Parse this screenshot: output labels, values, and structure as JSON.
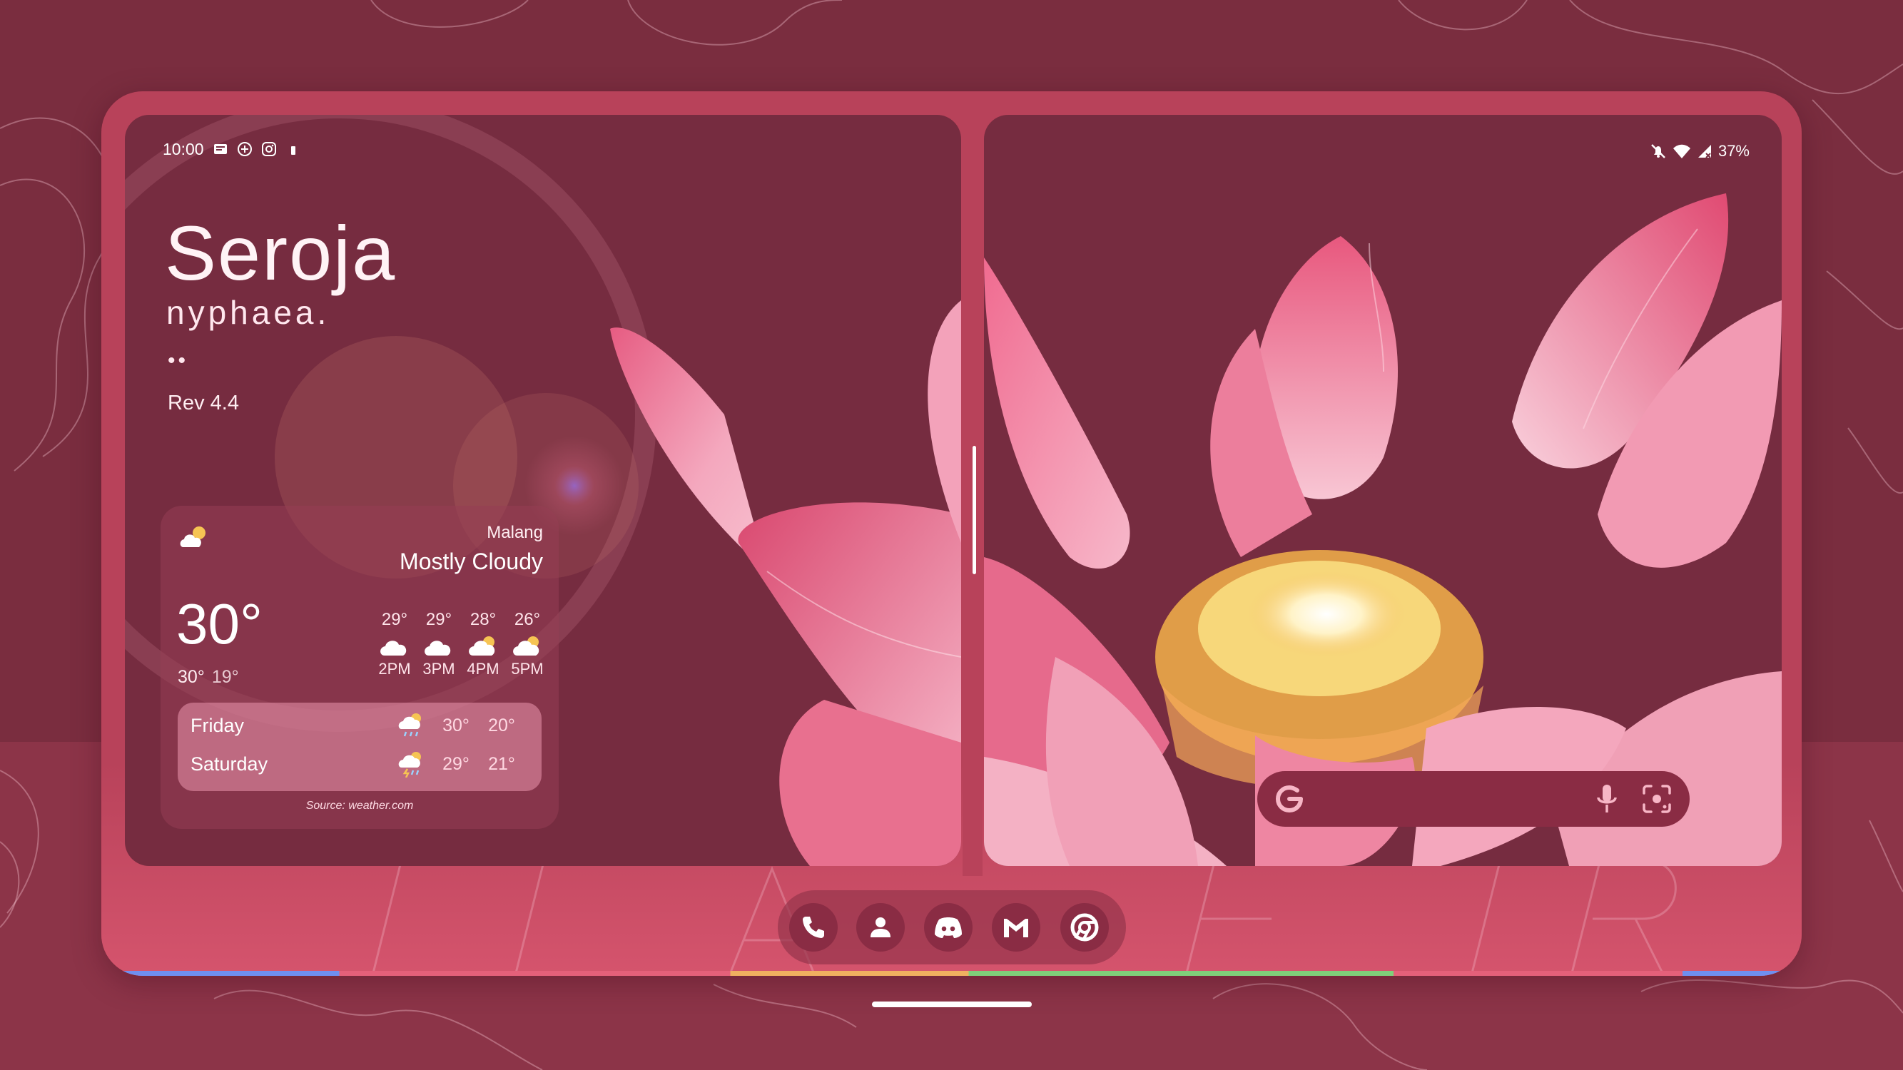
{
  "colors": {
    "background": "#7a2d3f",
    "frame": "#b8425a",
    "screen": "#762c40",
    "accent": "#8a2c44",
    "petal": "#f07a9a"
  },
  "status_left": {
    "time": "10:00",
    "icons": [
      "news-icon",
      "assistant-plus-icon",
      "instagram-icon",
      "battery-small-icon"
    ]
  },
  "status_right": {
    "icons": [
      "bell-off-icon",
      "wifi-icon",
      "signal-icon"
    ],
    "battery": "37%"
  },
  "title": {
    "main": "Seroja",
    "sub": "nyphaea.",
    "dots": "••",
    "revision": "Rev 4.4"
  },
  "weather": {
    "city": "Malang",
    "condition": "Mostly Cloudy",
    "temperature": "30°",
    "high": "30°",
    "low": "19°",
    "hourly": [
      {
        "temp": "29°",
        "label": "2PM",
        "icon": "cloud-icon"
      },
      {
        "temp": "29°",
        "label": "3PM",
        "icon": "cloud-icon"
      },
      {
        "temp": "28°",
        "label": "4PM",
        "icon": "partly-cloudy-icon"
      },
      {
        "temp": "26°",
        "label": "5PM",
        "icon": "partly-cloudy-icon"
      }
    ],
    "daily": [
      {
        "day": "Friday",
        "hi": "30°",
        "lo": "20°",
        "icon": "rain-icon"
      },
      {
        "day": "Saturday",
        "hi": "29°",
        "lo": "21°",
        "icon": "thunderstorm-icon"
      }
    ],
    "source": "Source: weather.com"
  },
  "search": {
    "logo": "G",
    "icons": [
      "google-g-icon",
      "mic-icon",
      "lens-icon"
    ]
  },
  "dock": {
    "apps": [
      "phone-icon",
      "contacts-icon",
      "discord-icon",
      "gmail-icon",
      "chrome-icon"
    ]
  }
}
